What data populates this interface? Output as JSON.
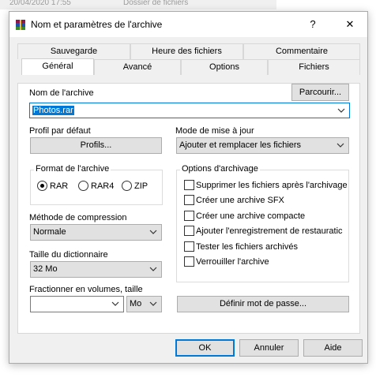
{
  "background_strip": {
    "date": "20/04/2020 17:55",
    "type": "Dossier de fichiers"
  },
  "window": {
    "title": "Nom et paramètres de l'archive",
    "help": "?",
    "close": "✕"
  },
  "tabs": {
    "row1": [
      "Sauvegarde",
      "Heure des fichiers",
      "Commentaire"
    ],
    "row2": [
      "Général",
      "Avancé",
      "Options",
      "Fichiers"
    ]
  },
  "archive_name": {
    "label": "Nom de l'archive",
    "value": "Photos.rar",
    "browse": "Parcourir..."
  },
  "default_profile": {
    "label": "Profil par défaut",
    "button": "Profils..."
  },
  "update_mode": {
    "label": "Mode de mise à jour",
    "value": "Ajouter et remplacer les fichiers"
  },
  "archive_format": {
    "label": "Format de l'archive",
    "options": [
      "RAR",
      "RAR4",
      "ZIP"
    ],
    "selected": "RAR"
  },
  "compression": {
    "label": "Méthode de compression",
    "value": "Normale"
  },
  "dictionary": {
    "label": "Taille du dictionnaire",
    "value": "32 Mo"
  },
  "split": {
    "label": "Fractionner en volumes, taille",
    "value": "",
    "unit": "Mo"
  },
  "archiving_options": {
    "label": "Options d'archivage",
    "items": [
      {
        "label": "Supprimer les fichiers après l'archivage",
        "checked": false
      },
      {
        "label": "Créer une archive SFX",
        "checked": false
      },
      {
        "label": "Créer une archive compacte",
        "checked": false
      },
      {
        "label": "Ajouter l'enregistrement de restauratic",
        "checked": false
      },
      {
        "label": "Tester les fichiers archivés",
        "checked": false
      },
      {
        "label": "Verrouiller l'archive",
        "checked": false
      }
    ]
  },
  "set_password": "Définir mot de passe...",
  "footer": {
    "ok": "OK",
    "cancel": "Annuler",
    "help": "Aide"
  },
  "colors": {
    "accent": "#0078d7",
    "dialog_bg": "#f0f0f0"
  }
}
